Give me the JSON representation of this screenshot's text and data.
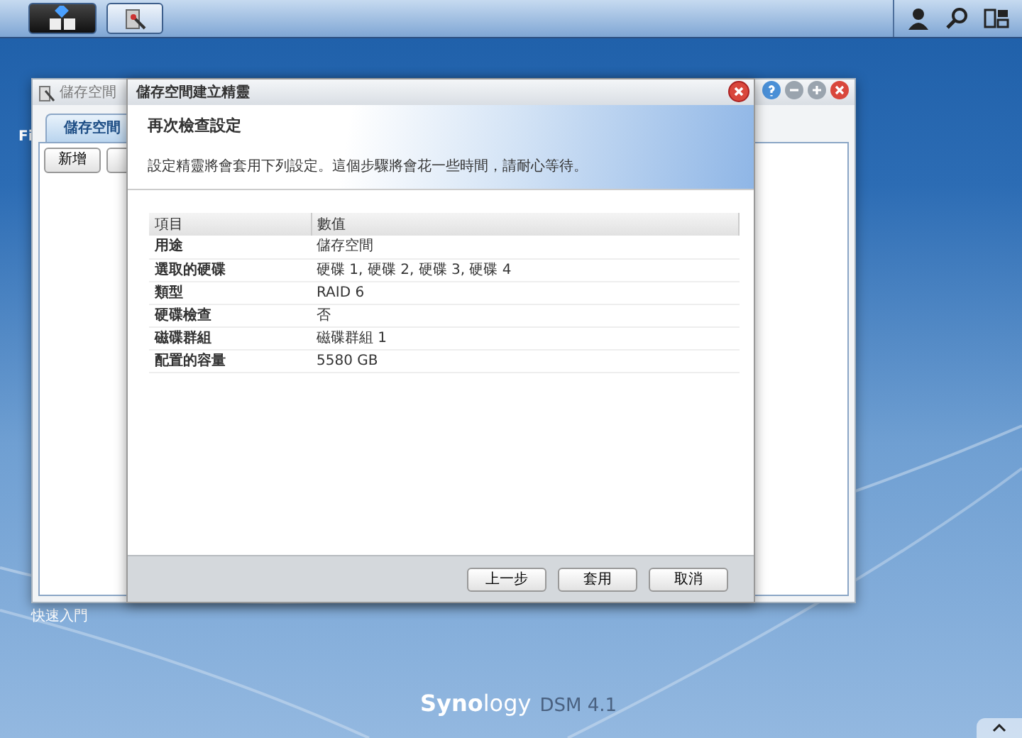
{
  "taskbar": {
    "buttons": [
      {
        "kind": "main-menu",
        "selected": true
      },
      {
        "kind": "app",
        "selected": false
      }
    ]
  },
  "desktop": {
    "icon_label": "Fi",
    "shortcut_label": "快速入門",
    "branding": {
      "name": "**Syno**logy",
      "version": "DSM 4.1"
    }
  },
  "background_window": {
    "title": "儲存空間",
    "tabs": [
      {
        "label": "儲存空間",
        "selected": true
      }
    ],
    "toolbar": [
      "新增"
    ]
  },
  "wizard": {
    "title": "儲存空間建立精靈",
    "heading": "再次檢查設定",
    "description": "設定精靈將會套用下列設定。這個步驟將會花一些時間，請耐心等待。",
    "table": {
      "columns": [
        "項目",
        "數值"
      ],
      "rows": [
        [
          "用途",
          "儲存空間"
        ],
        [
          "選取的硬碟",
          "硬碟 1, 硬碟 2, 硬碟 3, 硬碟 4"
        ],
        [
          "類型",
          "RAID 6"
        ],
        [
          "硬碟檢查",
          "否"
        ],
        [
          "磁碟群組",
          "磁碟群組 1"
        ],
        [
          "配置的容量",
          "5580 GB"
        ]
      ]
    },
    "buttons": [
      "上一步",
      "套用",
      "取消"
    ]
  }
}
